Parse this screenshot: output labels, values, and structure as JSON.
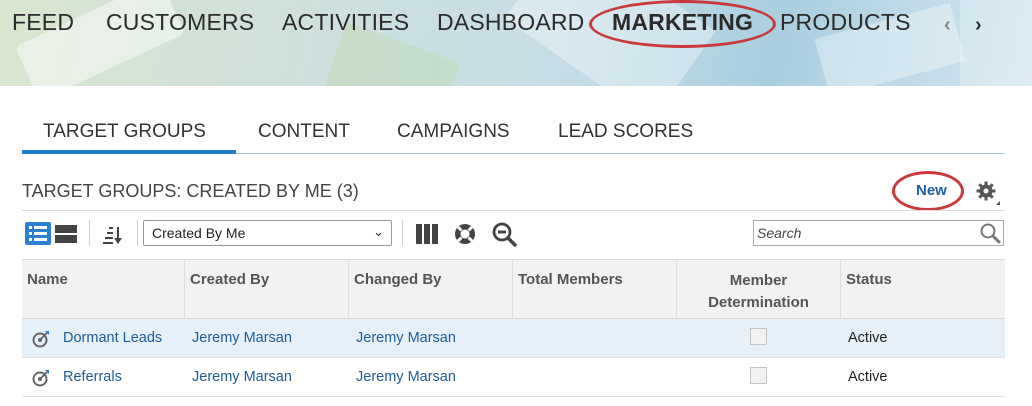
{
  "top_nav": {
    "items": [
      {
        "label": "FEED"
      },
      {
        "label": "CUSTOMERS"
      },
      {
        "label": "ACTIVITIES"
      },
      {
        "label": "DASHBOARD"
      },
      {
        "label": "MARKETING"
      },
      {
        "label": "PRODUCTS"
      }
    ],
    "active": "MARKETING",
    "prev_arrow": "‹",
    "next_arrow": "›"
  },
  "sub_tabs": {
    "items": [
      {
        "label": "TARGET GROUPS"
      },
      {
        "label": "CONTENT"
      },
      {
        "label": "CAMPAIGNS"
      },
      {
        "label": "LEAD SCORES"
      }
    ],
    "active": "TARGET GROUPS"
  },
  "section": {
    "title": "TARGET GROUPS: CREATED BY ME (3)",
    "new_label": "New"
  },
  "toolbar": {
    "query_value": "Created By Me",
    "search_placeholder": "Search"
  },
  "table": {
    "columns": [
      {
        "label": "Name"
      },
      {
        "label": "Created By"
      },
      {
        "label": "Changed By"
      },
      {
        "label": "Total Members"
      },
      {
        "label": "Member Determination"
      },
      {
        "label": "Status"
      }
    ],
    "rows": [
      {
        "name": "Dormant Leads",
        "created_by": "Jeremy Marsan",
        "changed_by": "Jeremy Marsan",
        "total_members": "",
        "member_determination": false,
        "status": "Active",
        "selected": true
      },
      {
        "name": "Referrals",
        "created_by": "Jeremy Marsan",
        "changed_by": "Jeremy Marsan",
        "total_members": "",
        "member_determination": false,
        "status": "Active",
        "selected": false
      }
    ]
  },
  "annotation_color": "#c9393b",
  "accent_color": "#1f7fcf",
  "icons": [
    "list-view-icon",
    "grid-view-icon",
    "sort-icon",
    "columns-icon",
    "lifebuoy-icon",
    "zoom-out-icon",
    "search-icon",
    "gear-icon",
    "target-group-icon"
  ]
}
